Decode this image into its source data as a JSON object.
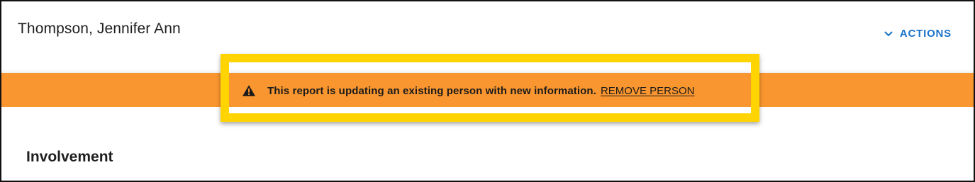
{
  "header": {
    "person_name": "Thompson, Jennifer Ann",
    "actions_label": "ACTIONS",
    "actions_icon": "chevron-down-icon"
  },
  "banner": {
    "icon": "warning-icon",
    "message": "This report is updating an existing person with new information.",
    "link_label": "REMOVE PERSON"
  },
  "section": {
    "title": "Involvement"
  },
  "colors": {
    "banner_background": "#fa962f",
    "highlight_outline": "#ffd400",
    "link_blue": "#1a73c8"
  }
}
